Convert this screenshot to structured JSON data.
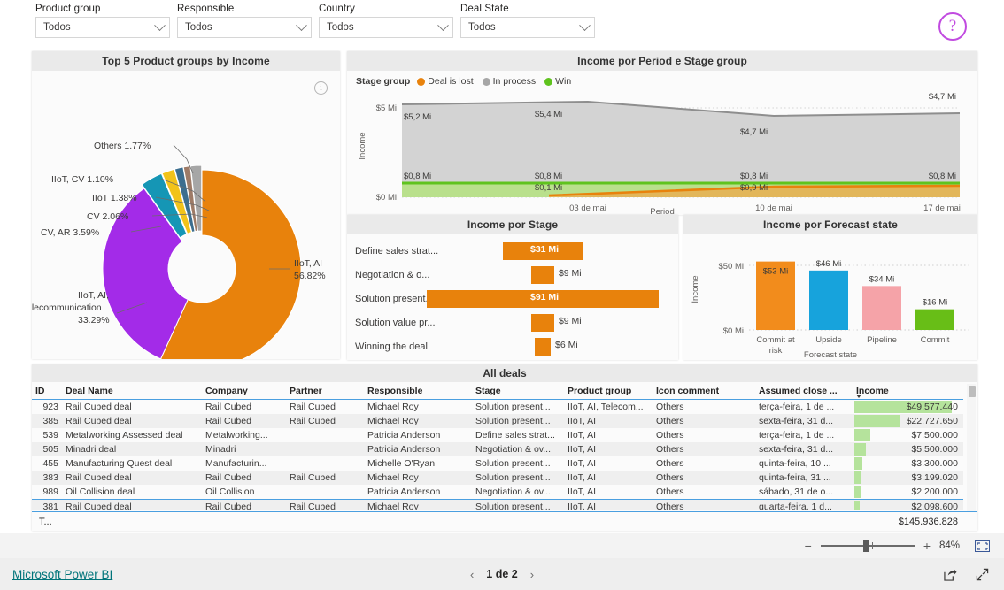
{
  "filters": [
    {
      "label": "Product group",
      "value": "Todos"
    },
    {
      "label": "Responsible",
      "value": "Todos"
    },
    {
      "label": "Country",
      "value": "Todos"
    },
    {
      "label": "Deal State",
      "value": "Todos"
    }
  ],
  "help_icon": "?",
  "info_icon": "i",
  "donut": {
    "title": "Top 5 Product groups by Income",
    "slices": [
      {
        "label": "IIoT, AI",
        "pct": "56.82%",
        "value": 56.82,
        "color": "#E8820C"
      },
      {
        "label": "IIoT, AI, Telecommunication",
        "pct": "33.29%",
        "value": 33.29,
        "color": "#A32BE8"
      },
      {
        "label": "CV, AR",
        "pct": "3.59%",
        "value": 3.59,
        "color": "#1596B5"
      },
      {
        "label": "CV",
        "pct": "2.06%",
        "value": 2.06,
        "color": "#F2C31A"
      },
      {
        "label": "IIoT",
        "pct": "1.38%",
        "value": 1.38,
        "color": "#3C6E8F"
      },
      {
        "label": "IIoT, CV",
        "pct": "1.10%",
        "value": 1.1,
        "color": "#9E7B67"
      },
      {
        "label": "Others",
        "pct": "1.77%",
        "value": 1.77,
        "color": "#A6A6A6"
      }
    ],
    "labels": {
      "others": "Others 1.77%",
      "iiot_cv": "IIoT, CV 1.10%",
      "iiot": "IIoT 1.38%",
      "cv": "CV 2.06%",
      "cv_ar": "CV, AR 3.59%",
      "main_l1": "IIoT, AI",
      "main_l2": "56.82%",
      "purple_l1": "IIoT, AI,",
      "purple_l2": "elecommunication",
      "purple_l3": "33.29%"
    }
  },
  "area": {
    "title": "Income por Period e Stage group",
    "legend_title": "Stage group",
    "legend": [
      {
        "name": "Deal is lost",
        "color": "#E8820C"
      },
      {
        "name": "In process",
        "color": "#A6A6A6"
      },
      {
        "name": "Win",
        "color": "#5FC31E"
      }
    ],
    "y_ticks": [
      "$5 Mi",
      "$0 Mi"
    ],
    "x_ticks": [
      "03 de mai",
      "10 de mai",
      "17 de mai"
    ],
    "y_axis_title": "Income",
    "x_axis_title": "Period",
    "data_labels": {
      "inproc_left": "$5,2 Mi",
      "inproc_mid": "$5,4 Mi",
      "inproc_r1": "$4,7 Mi",
      "inproc_r2": "$4,7 Mi",
      "win_left": "$0,8 Mi",
      "win_mid": "$0,8 Mi",
      "win_r1": "$0,8 Mi",
      "win_r2": "$0,8 Mi",
      "lost_mid": "$0,1 Mi",
      "lost_right": "$0,9 Mi"
    }
  },
  "stage": {
    "title": "Income por Stage",
    "rows": [
      {
        "label": "Define sales strat...",
        "value": 31,
        "display": "$31 Mi",
        "inside": true
      },
      {
        "label": "Negotiation & o...",
        "value": 9,
        "display": "$9 Mi",
        "inside": false
      },
      {
        "label": "Solution present...",
        "value": 91,
        "display": "$91 Mi",
        "inside": true
      },
      {
        "label": "Solution value pr...",
        "value": 9,
        "display": "$9 Mi",
        "inside": false
      },
      {
        "label": "Winning the deal",
        "value": 6,
        "display": "$6 Mi",
        "inside": false
      }
    ],
    "bar_color": "#E8820C"
  },
  "forecast": {
    "title": "Income por Forecast state",
    "y_ticks": [
      "$50 Mi",
      "$0 Mi"
    ],
    "y_axis_title": "Income",
    "x_axis_title": "Forecast state",
    "bars": [
      {
        "label": "Commit at risk",
        "label_l1": "Commit at",
        "label_l2": "risk",
        "value": 53,
        "display": "$53 Mi",
        "color": "#F28C1C",
        "label_inside": true
      },
      {
        "label": "Upside",
        "label_l1": "Upside",
        "label_l2": "",
        "value": 46,
        "display": "$46 Mi",
        "color": "#17A3DC",
        "label_inside": false
      },
      {
        "label": "Pipeline",
        "label_l1": "Pipeline",
        "label_l2": "",
        "value": 34,
        "display": "$34 Mi",
        "color": "#F5A3A8",
        "label_inside": false
      },
      {
        "label": "Commit",
        "label_l1": "Commit",
        "label_l2": "",
        "value": 16,
        "display": "$16 Mi",
        "color": "#68BE17",
        "label_inside": false
      }
    ]
  },
  "table": {
    "title": "All deals",
    "columns": [
      "ID",
      "Deal Name",
      "Company",
      "Partner",
      "Responsible",
      "Stage",
      "Product group",
      "Icon comment",
      "Assumed close ...",
      "Income"
    ],
    "sorted_column": "Income",
    "rows": [
      {
        "id": "923",
        "deal": "Rail Cubed deal",
        "company": "Rail Cubed",
        "partner": "Rail Cubed",
        "responsible": "Michael Roy",
        "stage": "Solution present...",
        "product": "IIoT, AI, Telecom...",
        "icon": "Others",
        "close": "terça-feira, 1 de ...",
        "income": "$49.577.440",
        "bar": 100
      },
      {
        "id": "385",
        "deal": "Rail Cubed deal",
        "company": "Rail Cubed",
        "partner": "Rail Cubed",
        "responsible": "Michael Roy",
        "stage": "Solution present...",
        "product": "IIoT, AI",
        "icon": "Others",
        "close": "sexta-feira, 31 d...",
        "income": "$22.727.650",
        "bar": 47
      },
      {
        "id": "539",
        "deal": "Metalworking Assessed deal",
        "company": "Metalworking...",
        "partner": "",
        "responsible": "Patricia Anderson",
        "stage": "Define sales strat...",
        "product": "IIoT, AI",
        "icon": "Others",
        "close": "terça-feira, 1 de ...",
        "income": "$7.500.000",
        "bar": 16
      },
      {
        "id": "505",
        "deal": "Minadri deal",
        "company": "Minadri",
        "partner": "",
        "responsible": "Patricia Anderson",
        "stage": "Negotiation & ov...",
        "product": "IIoT, AI",
        "icon": "Others",
        "close": "sexta-feira, 31 d...",
        "income": "$5.500.000",
        "bar": 12
      },
      {
        "id": "455",
        "deal": "Manufacturing Quest deal",
        "company": "Manufacturin...",
        "partner": "",
        "responsible": "Michelle O'Ryan",
        "stage": "Solution present...",
        "product": "IIoT, AI",
        "icon": "Others",
        "close": "quinta-feira, 10 ...",
        "income": "$3.300.000",
        "bar": 8
      },
      {
        "id": "383",
        "deal": "Rail Cubed deal",
        "company": "Rail Cubed",
        "partner": "Rail Cubed",
        "responsible": "Michael Roy",
        "stage": "Solution present...",
        "product": "IIoT, AI",
        "icon": "Others",
        "close": "quinta-feira, 31 ...",
        "income": "$3.199.020",
        "bar": 7
      },
      {
        "id": "989",
        "deal": "Oil Collision deal",
        "company": "Oil Collision",
        "partner": "",
        "responsible": "Patricia Anderson",
        "stage": "Negotiation & ov...",
        "product": "IIoT, AI",
        "icon": "Others",
        "close": "sábado, 31 de o...",
        "income": "$2.200.000",
        "bar": 6
      },
      {
        "id": "381",
        "deal": "Rail Cubed deal",
        "company": "Rail Cubed",
        "partner": "Rail Cubed",
        "responsible": "Michael Roy",
        "stage": "Solution present...",
        "product": "IIoT, AI",
        "icon": "Others",
        "close": "quarta-feira, 1 d...",
        "income": "$2.098.600",
        "bar": 5
      }
    ],
    "total_label": "T...",
    "total_value": "$145.936.828"
  },
  "zoombar": {
    "minus": "−",
    "plus": "+",
    "percent": "84%"
  },
  "footer": {
    "brand": "Microsoft Power BI",
    "prev": "‹",
    "page": "1 de 2",
    "next": "›"
  }
}
